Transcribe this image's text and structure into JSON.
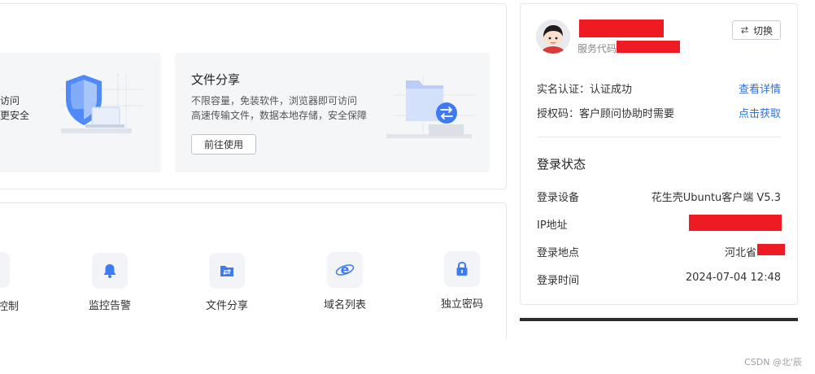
{
  "cards": {
    "security": {
      "desc_line1_tail": "访问",
      "desc_line2_tail": "更安全"
    },
    "share": {
      "title": "文件分享",
      "desc_line1": "不限容量，免装软件，浏览器即可访问",
      "desc_line2": "高速传输文件，数据本地存储，安全保障",
      "button_label": "前往使用"
    }
  },
  "functions": [
    {
      "label": "控制",
      "icon": "remote-control-icon"
    },
    {
      "label": "监控告警",
      "icon": "bell-icon"
    },
    {
      "label": "文件分享",
      "icon": "file-share-icon"
    },
    {
      "label": "域名列表",
      "icon": "browser-e-icon"
    },
    {
      "label": "独立密码",
      "icon": "lock-icon"
    }
  ],
  "account": {
    "service_code_label": "服务代码",
    "switch_label": "切换",
    "verification_label": "实名认证：认证成功",
    "verification_link": "查看详情",
    "auth_code_label": "授权码：客户顾问协助时需要",
    "auth_code_link": "点击获取"
  },
  "login_status": {
    "title": "登录状态",
    "device_label": "登录设备",
    "device_value": "花生壳Ubuntu客户端 V5.3",
    "ip_label": "IP地址",
    "location_label": "登录地点",
    "location_value": "河北省",
    "time_label": "登录时间",
    "time_value": "2024-07-04 12:48"
  },
  "watermark": "CSDN @北'辰",
  "colors": {
    "accent": "#2f6fe4",
    "icon_blue": "#3d7bf5",
    "redaction": "#ef1b23"
  }
}
